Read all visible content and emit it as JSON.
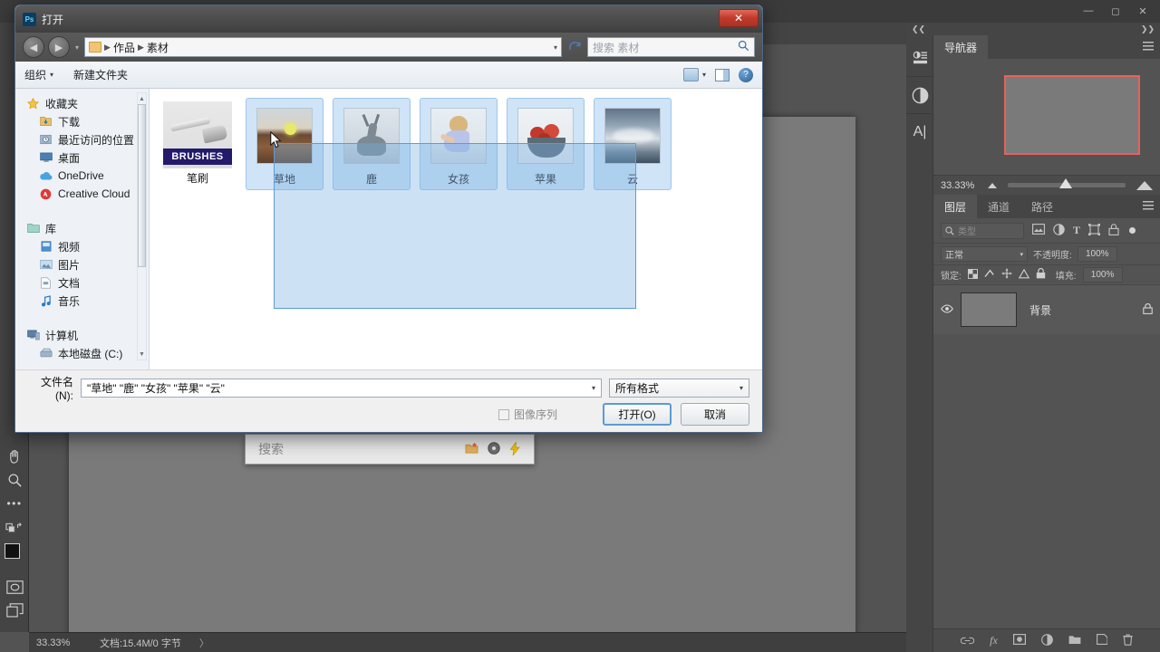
{
  "photoshop": {
    "window_controls": {
      "minimize": "—",
      "maximize": "◻",
      "close": "✕"
    },
    "menubar_icons": {
      "search": "search-icon",
      "workspace": "workspace-icon",
      "chevron": "⌄"
    },
    "toolbox": [
      {
        "name": "hand-tool",
        "glyph": "✋"
      },
      {
        "name": "zoom-tool",
        "glyph": "🔍"
      },
      {
        "name": "edit-toolbar-tool",
        "glyph": "•••"
      },
      {
        "name": "quick-mask-tool",
        "glyph": "◳"
      },
      {
        "name": "screen-mode-tool",
        "glyph": "❐"
      }
    ],
    "canvas_search": {
      "placeholder": "搜索",
      "icons": [
        "folder-star-icon",
        "disc-icon",
        "lightning-icon"
      ]
    },
    "statusbar": {
      "zoom": "33.33%",
      "doc_info": "文档:15.4M/0 字节",
      "arrow": "〉"
    }
  },
  "dock": {
    "rail_icons": [
      "adjustments-icon",
      "half-circle-icon",
      "type-icon"
    ],
    "collapse_left": "❮❮",
    "collapse_right": "❯❯",
    "navigator": {
      "tab": "导航器",
      "menu_icon": "panel-menu-icon",
      "zoom_value": "33.33%"
    },
    "layers": {
      "tabs": [
        {
          "label": "图层",
          "active": true
        },
        {
          "label": "通道",
          "active": false
        },
        {
          "label": "路径",
          "active": false
        }
      ],
      "menu_icon": "panel-menu-icon",
      "filter_placeholder": "类型",
      "filter_icons": [
        "image-filter-icon",
        "adjustment-filter-icon",
        "type-filter-icon",
        "shape-filter-icon",
        "smart-object-filter-icon"
      ],
      "blend_mode": "正常",
      "opacity_label": "不透明度:",
      "opacity_value": "100%",
      "lock_label": "锁定:",
      "fill_label": "填充:",
      "fill_value": "100%",
      "lock_icons": [
        "lock-transparent-icon",
        "lock-image-icon",
        "lock-position-icon",
        "lock-artboard-icon",
        "lock-all-icon"
      ],
      "layer_rows": [
        {
          "name": "背景",
          "visible": true,
          "locked": true
        }
      ],
      "footer_icons": [
        "link-icon",
        "fx-icon",
        "mask-icon",
        "adjustment-icon",
        "group-icon",
        "new-layer-icon",
        "delete-icon"
      ]
    }
  },
  "dialog": {
    "title": "打开",
    "app_icon": "Ps",
    "close_label": "✕",
    "nav": {
      "back": "◀",
      "forward": "▶",
      "history_caret": "▾",
      "breadcrumbs": [
        "作品",
        "素材"
      ],
      "address_dropdown": "▾",
      "refresh_icon": "refresh-icon",
      "search_placeholder": "搜索 素材",
      "search_icon": "search-icon"
    },
    "toolbar": {
      "organize": "组织",
      "organize_caret": "▾",
      "new_folder": "新建文件夹",
      "view_icon": "view-mode-icon",
      "view_caret": "▾",
      "preview_pane_icon": "preview-pane-icon",
      "help_icon": "?"
    },
    "sidebar": [
      {
        "label": "收藏夹",
        "icon": "star-icon",
        "level": 0
      },
      {
        "label": "下载",
        "icon": "downloads-icon",
        "level": 1
      },
      {
        "label": "最近访问的位置",
        "icon": "recent-icon",
        "level": 1
      },
      {
        "label": "桌面",
        "icon": "desktop-icon",
        "level": 1
      },
      {
        "label": "OneDrive",
        "icon": "onedrive-icon",
        "level": 1
      },
      {
        "label": "Creative Cloud",
        "icon": "creative-cloud-icon",
        "level": 1
      },
      {
        "label": "库",
        "icon": "library-icon",
        "level": 0,
        "gap_before": true
      },
      {
        "label": "视频",
        "icon": "video-icon",
        "level": 1
      },
      {
        "label": "图片",
        "icon": "pictures-icon",
        "level": 1
      },
      {
        "label": "文档",
        "icon": "documents-icon",
        "level": 1
      },
      {
        "label": "音乐",
        "icon": "music-icon",
        "level": 1
      },
      {
        "label": "计算机",
        "icon": "computer-icon",
        "level": 0,
        "gap_before": true
      },
      {
        "label": "本地磁盘 (C:)",
        "icon": "harddisk-icon",
        "level": 1
      }
    ],
    "files": [
      {
        "label": "笔刷",
        "thumb": "brushes-thumb",
        "selected": false,
        "badge": "BRUSHES"
      },
      {
        "label": "草地",
        "thumb": "grass-thumb",
        "selected": true
      },
      {
        "label": "鹿",
        "thumb": "deer-thumb",
        "selected": true
      },
      {
        "label": "女孩",
        "thumb": "girl-thumb",
        "selected": true
      },
      {
        "label": "苹果",
        "thumb": "apple-thumb",
        "selected": true
      },
      {
        "label": "云",
        "thumb": "cloud-thumb",
        "selected": true
      }
    ],
    "footer": {
      "filename_label": "文件名(N):",
      "filename_value": "\"草地\" \"鹿\" \"女孩\" \"苹果\" \"云\"",
      "filename_caret": "▾",
      "format_value": "所有格式",
      "format_caret": "▾",
      "image_sequence_label": "图像序列",
      "image_sequence_checked": false,
      "open_button": "打开(O)",
      "cancel_button": "取消"
    }
  }
}
